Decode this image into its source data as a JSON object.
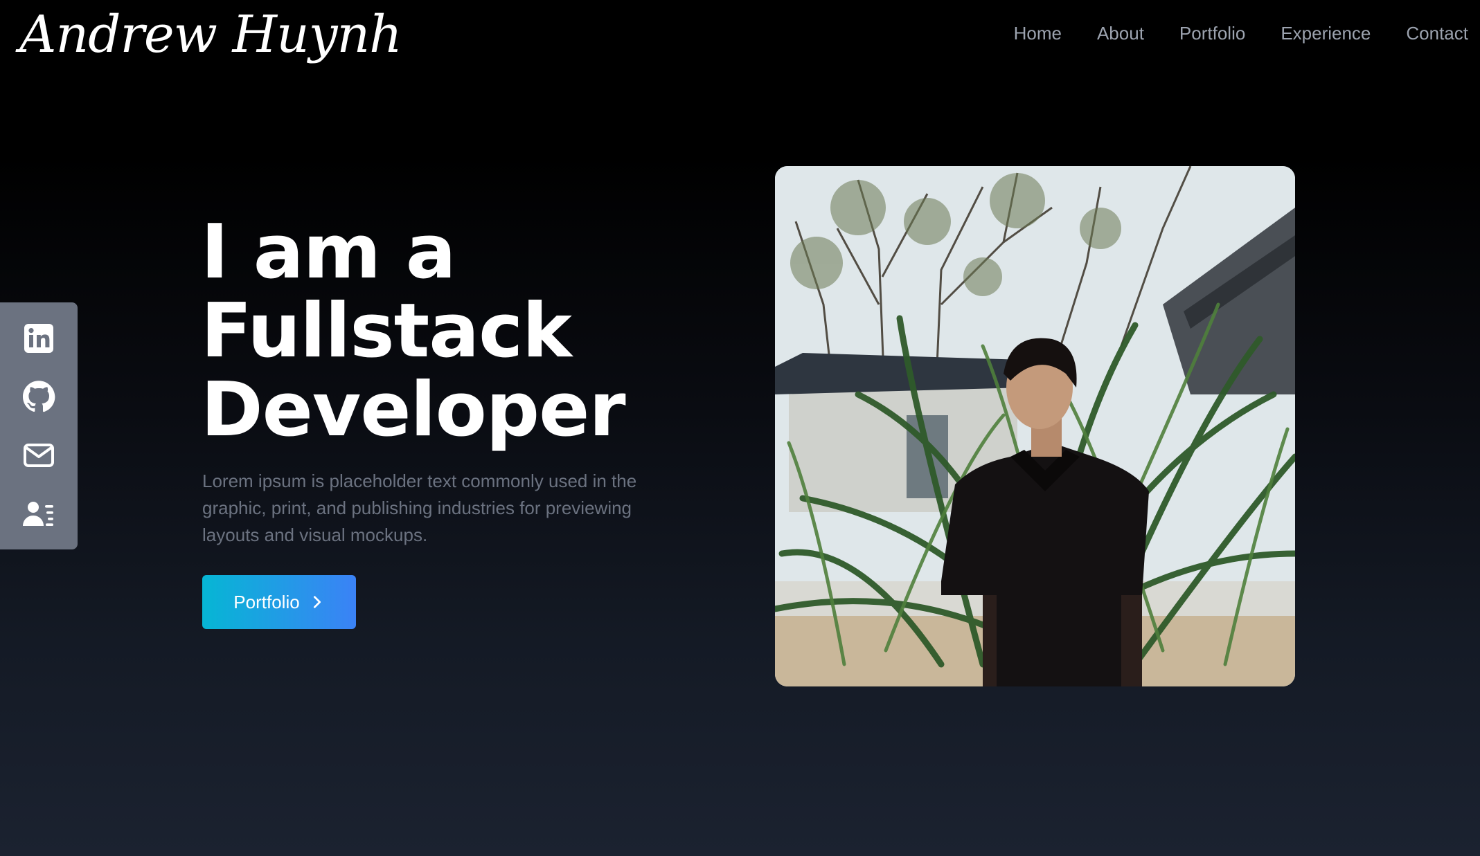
{
  "header": {
    "logo_text": "Andrew Huynh",
    "nav": [
      {
        "label": "Home"
      },
      {
        "label": "About"
      },
      {
        "label": "Portfolio"
      },
      {
        "label": "Experience"
      },
      {
        "label": "Contact"
      }
    ]
  },
  "social": {
    "items": [
      {
        "icon": "linkedin-icon"
      },
      {
        "icon": "github-icon"
      },
      {
        "icon": "mail-icon"
      },
      {
        "icon": "resume-icon"
      }
    ],
    "panel_color": "#6b7280"
  },
  "hero": {
    "headline_lines": [
      "I am a",
      "Fullstack",
      "Developer"
    ],
    "description": "Lorem ipsum is placeholder text commonly used in the graphic, print, and publishing industries for previewing layouts and visual mockups.",
    "cta_label": "Portfolio",
    "cta_gradient": [
      "#06b6d4",
      "#3b82f6"
    ]
  }
}
